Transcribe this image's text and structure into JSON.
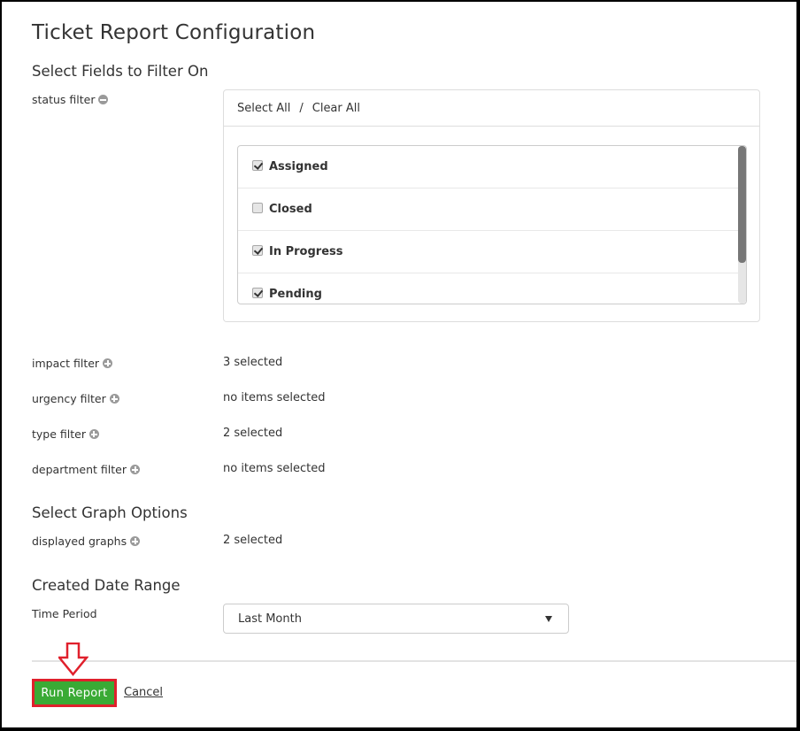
{
  "page": {
    "title": "Ticket Report Configuration"
  },
  "sections": {
    "filters_heading": "Select Fields to Filter On",
    "graph_heading": "Select Graph Options",
    "date_heading": "Created Date Range"
  },
  "status_filter": {
    "label": "status filter",
    "toggle_icon": "minus-circle-icon",
    "select_all": "Select All",
    "separator": "/",
    "clear_all": "Clear All",
    "options": [
      {
        "label": "Assigned",
        "checked": true
      },
      {
        "label": "Closed",
        "checked": false
      },
      {
        "label": "In Progress",
        "checked": true
      },
      {
        "label": "Pending",
        "checked": true
      }
    ]
  },
  "filters": [
    {
      "label": "impact filter",
      "value": "3 selected",
      "icon": "plus-circle-icon"
    },
    {
      "label": "urgency filter",
      "value": "no items selected",
      "icon": "plus-circle-icon"
    },
    {
      "label": "type filter",
      "value": "2 selected",
      "icon": "plus-circle-icon"
    },
    {
      "label": "department filter",
      "value": "no items selected",
      "icon": "plus-circle-icon"
    }
  ],
  "graph_options": {
    "label": "displayed graphs",
    "value": "2 selected",
    "icon": "plus-circle-icon"
  },
  "date_range": {
    "label": "Time Period",
    "selected": "Last Month"
  },
  "actions": {
    "run_report": "Run Report",
    "cancel": "Cancel"
  },
  "colors": {
    "run_button_bg": "#3aaa35",
    "annotation_red": "#e0202c"
  }
}
